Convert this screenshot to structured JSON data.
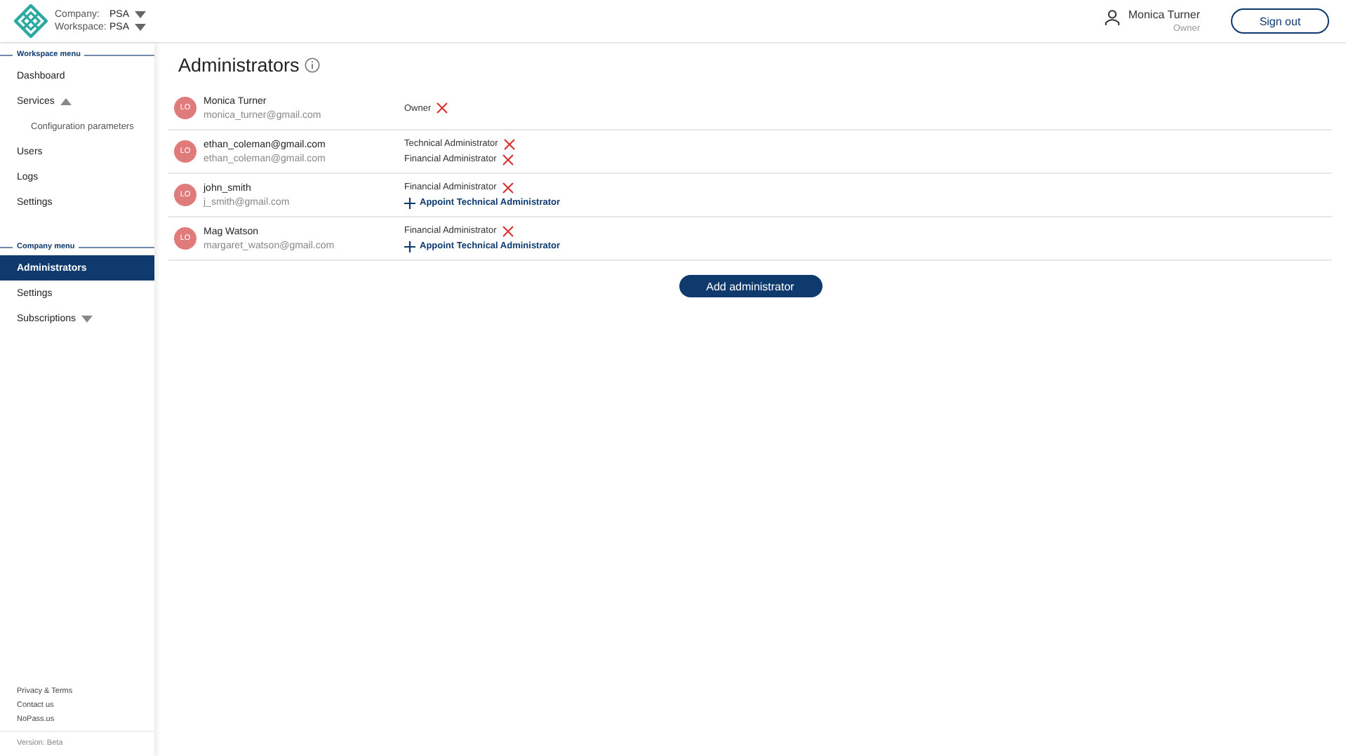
{
  "header": {
    "selectors": [
      {
        "label": "Company:",
        "value": "PSA"
      },
      {
        "label": "Workspace:",
        "value": "PSA"
      }
    ],
    "user": {
      "name": "Monica Turner",
      "role": "Owner"
    },
    "sign_out": "Sign out"
  },
  "sidebar": {
    "sections": [
      {
        "title": "Workspace menu",
        "items": [
          {
            "label": "Dashboard",
            "selected": false
          },
          {
            "label": "Services",
            "selected": false,
            "expanded": true,
            "children": [
              {
                "label": "Configuration parameters",
                "selected": false
              }
            ]
          },
          {
            "label": "Users",
            "selected": false
          },
          {
            "label": "Logs",
            "selected": false
          },
          {
            "label": "Settings",
            "selected": false
          }
        ]
      },
      {
        "title": "Company menu",
        "items": [
          {
            "label": "Administrators",
            "selected": true
          },
          {
            "label": "Settings",
            "selected": false
          },
          {
            "label": "Subscriptions",
            "selected": false,
            "expanded": false
          }
        ]
      }
    ],
    "footer_links": [
      "Privacy & Terms",
      "Contact us",
      "NoPass.us"
    ],
    "version": "Version: Beta"
  },
  "page": {
    "title": "Administrators",
    "admins": [
      {
        "initials": "LO",
        "name": "Monica Turner",
        "email": "monica_turner@gmail.com",
        "roles": [
          {
            "kind": "role",
            "label": "Owner"
          }
        ]
      },
      {
        "initials": "LO",
        "name": "ethan_coleman@gmail.com",
        "email": "ethan_coleman@gmail.com",
        "roles": [
          {
            "kind": "role",
            "label": "Technical Administrator"
          },
          {
            "kind": "role",
            "label": "Financial Administrator"
          }
        ]
      },
      {
        "initials": "LO",
        "name": "john_smith",
        "email": "j_smith@gmail.com",
        "roles": [
          {
            "kind": "role",
            "label": "Financial Administrator"
          },
          {
            "kind": "appoint",
            "label": "Appoint Technical Administrator"
          }
        ]
      },
      {
        "initials": "LO",
        "name": "Mag Watson",
        "email": "margaret_watson@gmail.com",
        "roles": [
          {
            "kind": "role",
            "label": "Financial Administrator"
          },
          {
            "kind": "appoint",
            "label": "Appoint Technical Administrator"
          }
        ]
      }
    ],
    "add_button": "Add administrator"
  }
}
